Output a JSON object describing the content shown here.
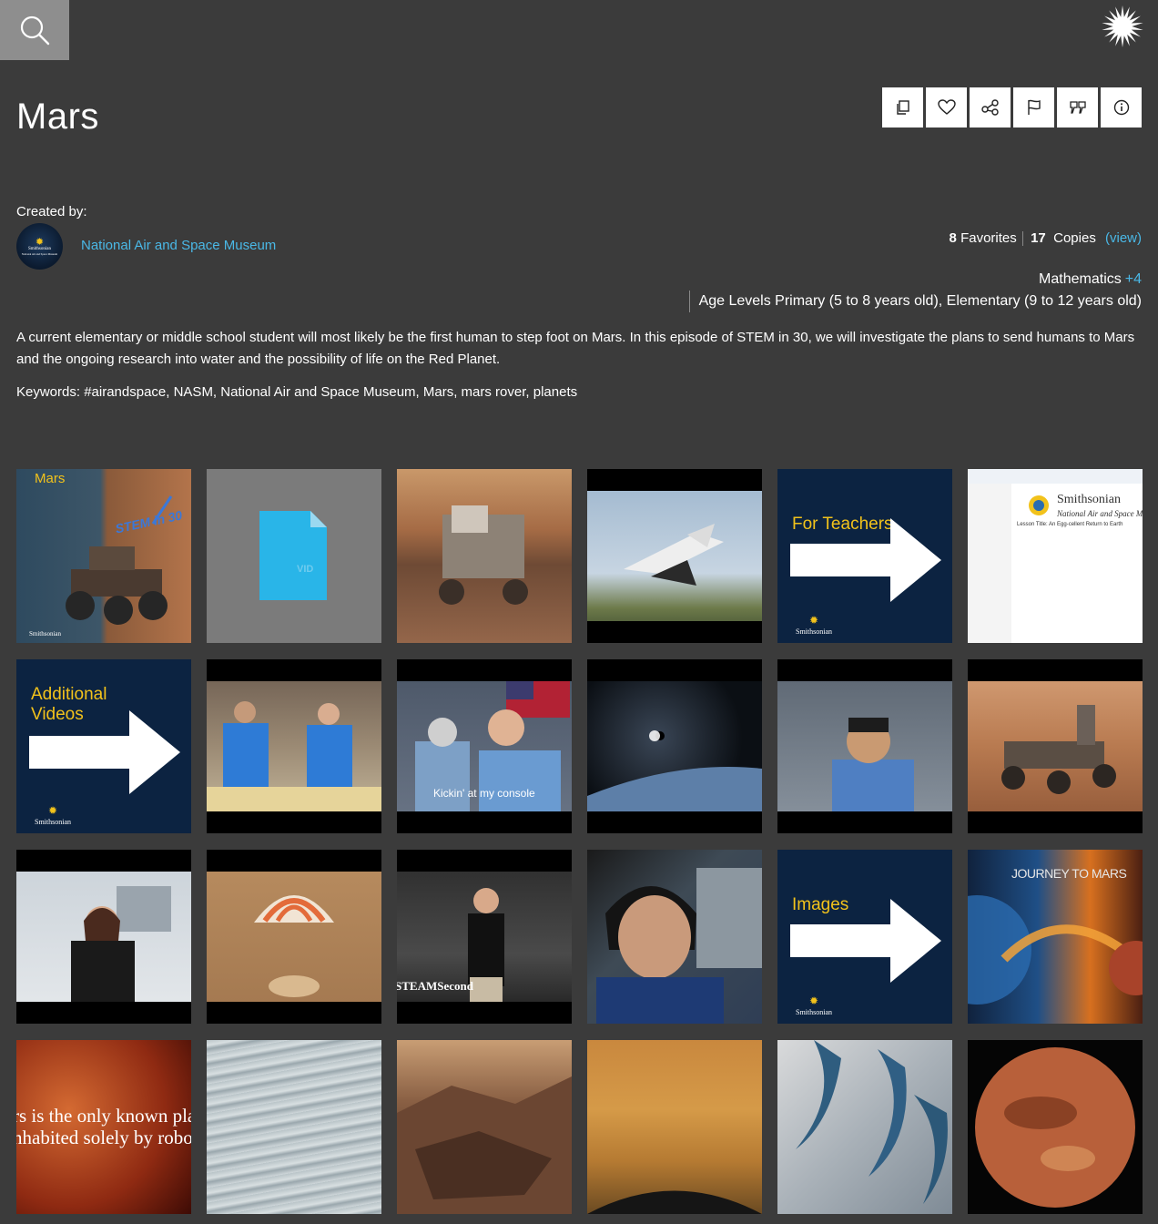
{
  "header": {
    "search_icon": "magnifying-glass",
    "logo_icon": "smithsonian-sunburst"
  },
  "title": "Mars",
  "actions": [
    {
      "name": "copy",
      "icon": "copy-icon"
    },
    {
      "name": "favorite",
      "icon": "heart-icon"
    },
    {
      "name": "share",
      "icon": "share-icon"
    },
    {
      "name": "report",
      "icon": "flag-icon"
    },
    {
      "name": "cite",
      "icon": "quote-icon"
    },
    {
      "name": "info",
      "icon": "info-icon"
    }
  ],
  "creator": {
    "label": "Created by:",
    "name": "National Air and Space Museum",
    "avatar_text_1": "Smithsonian",
    "avatar_text_2": "National Air and Space Museum"
  },
  "stats": {
    "favorites_count": "8",
    "favorites_label": "Favorites",
    "copies_count": "17",
    "copies_label": "Copies",
    "view_link": "(view)"
  },
  "subject": {
    "name": "Mathematics",
    "more": "+4"
  },
  "ages": "Age Levels Primary (5 to 8 years old), Elementary (9 to 12 years old)",
  "description": "A current elementary or middle school student will most likely be the first human to step foot on Mars. In this episode of STEM in 30, we will investigate the plans to send humans to Mars and the ongoing research into water and the possibility of life on the Red Planet.",
  "keywords": "Keywords: #airandspace, NASM, National Air and Space Museum, Mars, mars rover, planets",
  "tiles": {
    "t1_title": "Mars",
    "t1_logo": "STEM in 30",
    "t1_brand": "Smithsonian",
    "t2_label": "VID",
    "t6_brand": "Smithsonian",
    "t6_sub": "National Air and Space Museum",
    "t6_lesson": "Lesson Title: An Egg-cellent Return to Earth",
    "t5_title": "For Teachers",
    "t7_title": "Additional Videos",
    "t15_title": "Images",
    "t9_caption": "Kickin' at my console",
    "t15_caption": "STEAMSecond",
    "t18_title": "JOURNEY TO MARS",
    "t19_caption_1": "rs is the only known pla",
    "t19_caption_2": "nhabited solely by robots",
    "brand_name": "Smithsonian",
    "brand_sub": "National Air and Space Museum"
  },
  "colors": {
    "background": "#3b3b3b",
    "link": "#4ab8e6",
    "navy": "#0c2341",
    "gold": "#f2c21b"
  }
}
